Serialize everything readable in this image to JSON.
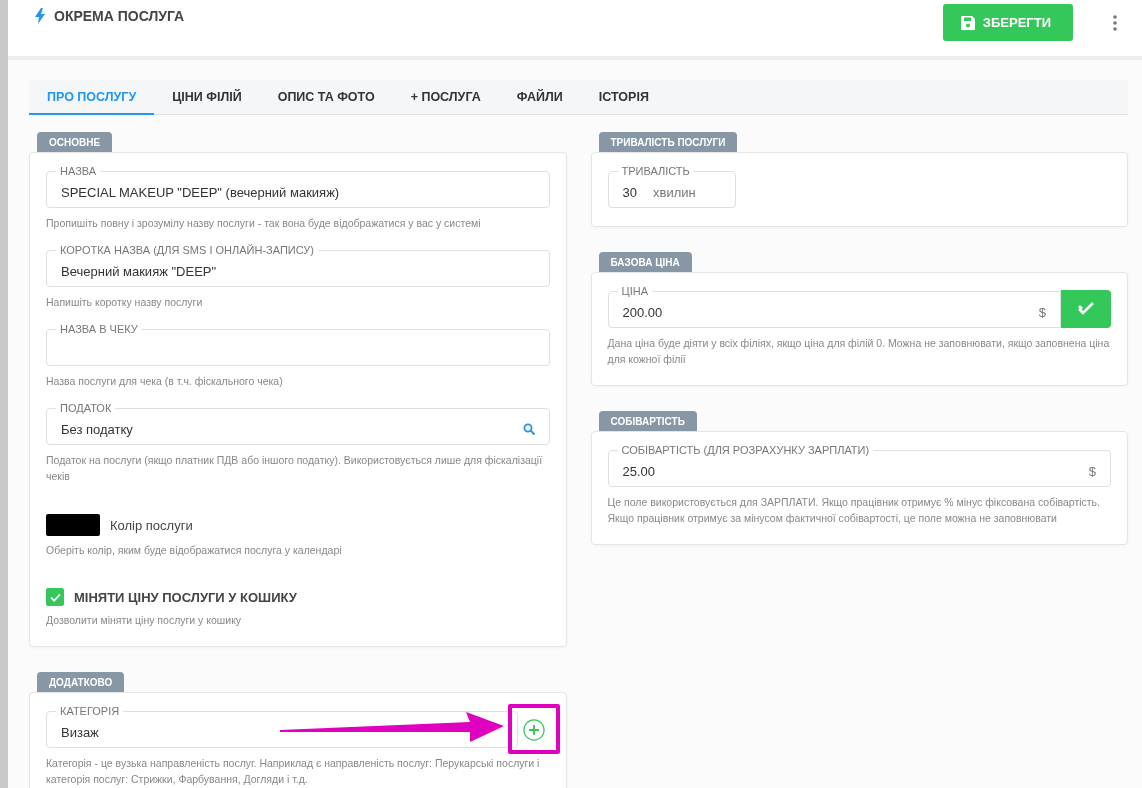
{
  "header": {
    "title": "ОКРЕМА ПОСЛУГА",
    "save_button": "ЗБЕРЕГТИ"
  },
  "tabs": [
    {
      "label": "ПРО ПОСЛУГУ",
      "selected": true
    },
    {
      "label": "ЦІНИ ФІЛІЙ",
      "selected": false
    },
    {
      "label": "ОПИС ТА ФОТО",
      "selected": false
    },
    {
      "label": "+ ПОСЛУГА",
      "selected": false
    },
    {
      "label": "ФАЙЛИ",
      "selected": false
    },
    {
      "label": "ІСТОРІЯ",
      "selected": false
    }
  ],
  "left_sections": [
    {
      "title": "ОСНОВНЕ",
      "items": [
        {
          "kind": "field",
          "label": "НАЗВА",
          "value": "SPECIAL MAKEUP \"DEEP\" (вечерний макияж)",
          "hint": "Пропишіть повну і зрозумілу назву послуги - так вона буде відображатися у вас у системі"
        },
        {
          "kind": "field",
          "label": "КОРОТКА НАЗВА (ДЛЯ SMS І ОНЛАЙН-ЗАПИСУ)",
          "value": "Вечерний макияж \"DEEP\"",
          "hint": "Напишіть коротку назву послуги"
        },
        {
          "kind": "field",
          "label": "НАЗВА В ЧЕКУ",
          "hint": "Назва послуги для чека (в т.ч. фіскального чека)"
        },
        {
          "kind": "field",
          "label": "ПОДАТОК",
          "value": "Без податку",
          "search": true,
          "hint": "Податок на послуги (якщо платник ПДВ або іншого податку). Використовується лише для фіскалізації чеків"
        },
        {
          "kind": "color",
          "label": "Колір послуги",
          "color": "#000000",
          "hint": "Оберіть колір, яким буде відображатися послуга у календарі"
        },
        {
          "kind": "checkbox",
          "label": "МІНЯТИ ЦІНУ ПОСЛУГИ У КОШИКУ",
          "checked": true,
          "hint": "Дозволити міняти ціну послуги у кошику"
        }
      ]
    },
    {
      "title": "ДОДАТКОВО",
      "items": [
        {
          "kind": "field",
          "label": "КАТЕГОРІЯ",
          "value": "Визаж",
          "add_button": true,
          "highlighted": true,
          "hint": "Категорія - це вузька направленість послуг. Наприклад є направленість послуг: Перукарські послуги і категорія послуг: Стрижки, Фарбування, Догляди і т.д."
        }
      ]
    }
  ],
  "right_sections": [
    {
      "title": "ТРИВАЛІСТЬ ПОСЛУГИ",
      "items": [
        {
          "kind": "duration",
          "label": "ТРИВАЛІСТЬ",
          "value": "30",
          "suffix": "хвилин"
        }
      ]
    },
    {
      "title": "БАЗОВА ЦІНА",
      "items": [
        {
          "kind": "field",
          "label": "ЦІНА",
          "value": "200.00",
          "suffix": "$",
          "confirm_button": true,
          "hint": "Дана ціна буде діяти у всіх філіях, якщо ціна для філій 0. Можна не заповнювати, якщо заповнена ціна для кожної філії"
        }
      ]
    },
    {
      "title": "СОБІВАРТІСТЬ",
      "items": [
        {
          "kind": "field",
          "label": "СОБІВАРТІСТЬ (ДЛЯ РОЗРАХУНКУ ЗАРПЛАТИ)",
          "value": "25.00",
          "suffix": "$",
          "hint": "Це поле використовується для ЗАРПЛАТИ. Якщо працівник отримує % мінус фіксована собівартість. Якщо працівник отримує за мінусом фактичної собівартості, це поле можна не заповнювати"
        }
      ]
    }
  ]
}
